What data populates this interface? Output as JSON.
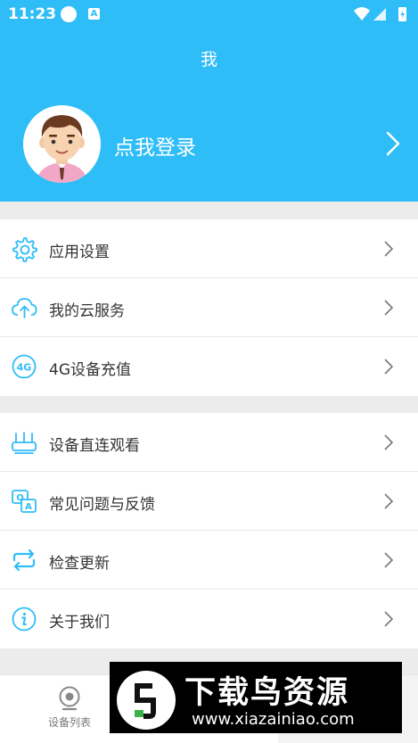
{
  "status_bar": {
    "time": "11:23",
    "badge_letter": "A"
  },
  "header": {
    "title": "我",
    "login_text": "点我登录"
  },
  "menu_group_1": [
    {
      "label": "应用设置",
      "icon": "gear-icon"
    },
    {
      "label": "我的云服务",
      "icon": "cloud-upload-icon"
    },
    {
      "label": "4G设备充值",
      "icon": "4g-icon"
    }
  ],
  "menu_group_2": [
    {
      "label": "设备直连观看",
      "icon": "router-icon"
    },
    {
      "label": "常见问题与反馈",
      "icon": "faq-chat-icon"
    },
    {
      "label": "检查更新",
      "icon": "refresh-arrows-icon"
    },
    {
      "label": "关于我们",
      "icon": "info-icon"
    }
  ],
  "tab_bar": {
    "devices_label": "设备列表"
  },
  "watermark": {
    "title": "下载鸟资源",
    "url": "www.xiazainiao.com"
  },
  "colors": {
    "accent": "#2ebdf7",
    "icon": "#2ebdf7",
    "background": "#ececec",
    "text": "#333333"
  }
}
